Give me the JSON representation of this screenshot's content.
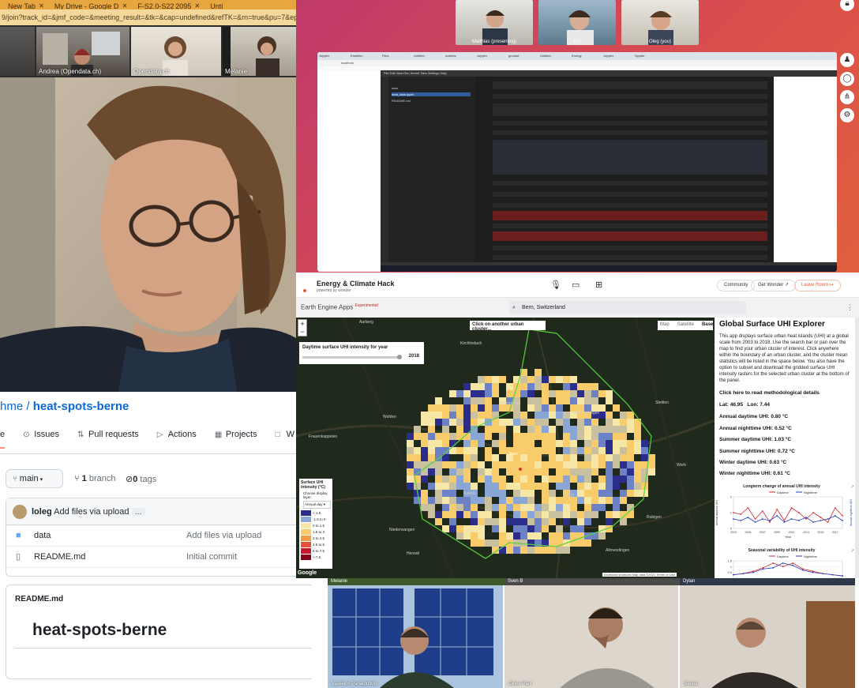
{
  "browser": {
    "tabs": [
      "New Tab",
      "My Drive - Google D",
      "F-S2.0-S22 2095",
      "Unti"
    ],
    "url": "9/join?track_id=&jmf_code=&meeting_result=&tk=&cap=undefined&refTK=&rn=true&pu=7&epk=8dFpZdV74"
  },
  "participants_top": [
    "Andrea (Opendata.ch)",
    "Opendata.ch",
    "Melanie"
  ],
  "participants_right": [
    "Matthias (presenting)",
    "Izzi",
    "Oleg (you)"
  ],
  "github": {
    "owner": "hme",
    "separator": " / ",
    "repo": "heat-spots-berne",
    "tabs": [
      {
        "icon": "⊙",
        "label": "Issues"
      },
      {
        "icon": "⇅",
        "label": "Pull requests"
      },
      {
        "icon": "▷",
        "label": "Actions"
      },
      {
        "icon": "▦",
        "label": "Projects"
      },
      {
        "icon": "□",
        "label": "W"
      }
    ],
    "first_tab_fragment": "e",
    "branch": "main",
    "branch_count": "1",
    "branch_label": "branch",
    "tag_count": "0",
    "tag_label": "tags",
    "commit_author": "loleg",
    "commit_message": "Add files via upload",
    "files": [
      {
        "name": "data",
        "message": "Add files via upload",
        "type": "folder"
      },
      {
        "name": "README.md",
        "message": "Initial commit",
        "type": "file"
      }
    ],
    "readme_label": "README.md",
    "readme_title": "heat-spots-berne"
  },
  "jupyter": {
    "address": "localhost",
    "tab_labels": [
      "Jupyter",
      "Erstellen",
      "Files",
      "Untitled",
      "mathviz",
      "Jupyter",
      "grundst",
      "Untitled",
      "Energy",
      "Jupyter",
      "Spyder"
    ],
    "file_items": [
      "data",
      "heat_data.ipynb",
      "README.md"
    ],
    "menu": "File  Edit  View  Run  Kernel  Tabs  Settings  Help"
  },
  "wonder": {
    "title": "Energy & Climate Hack",
    "subtitle": "powered by wonder",
    "community": "Community",
    "get_wonder": "Get Wonder",
    "leave_room": "Leave Room"
  },
  "earth_engine": {
    "title": "Earth Engine Apps",
    "badge": "Experimental",
    "search_value": "Bern, Switzerland"
  },
  "map": {
    "instruction": "Click on another urban cluster...",
    "map_types": [
      "Map",
      "Satellite",
      "Base"
    ],
    "year_panel_title": "Daytime surface UHI intensity for year",
    "year": "2018",
    "zoom_in": "+",
    "zoom_out": "−",
    "legend_title": "Surface UHI intensity (°C)",
    "legend_choose": "Choose display layer:",
    "legend_layer": "Annual day",
    "legend": [
      {
        "label": "< 1.5",
        "color": "#2b2d8a"
      },
      {
        "label": "-1.5 to 0",
        "color": "#8aa6d6"
      },
      {
        "label": "0 to 1.5",
        "color": "#f7e7a6"
      },
      {
        "label": "1.5 to 3",
        "color": "#f8cc6a"
      },
      {
        "label": "3 to 4.5",
        "color": "#f29c46"
      },
      {
        "label": "4.5 to 6",
        "color": "#e2543a"
      },
      {
        "label": "6 to 7.5",
        "color": "#c41a2a"
      },
      {
        "label": "> 7.5",
        "color": "#8a0016"
      }
    ],
    "places": [
      "Aarberg",
      "Kirchlindach",
      "Bremgarten",
      "Wohlen",
      "Frauenkappelen",
      "Bern",
      "Ostermundigen",
      "Muri",
      "Niederwangen",
      "Koeniz",
      "Allmendingen",
      "Rubigen",
      "Worb",
      "Stettlen",
      "Herzwil"
    ],
    "attribution": "Google",
    "footer": "Keyboard shortcuts   Map data ©2021   Terms of Use"
  },
  "panel": {
    "title": "Global Surface UHI Explorer",
    "description": "This app displays surface urban heat islands (UHI) at a global scale from 2003 to 2018. Use the search bar or pan over the map to find your urban cluster of interest. Click anywhere within the boundary of an urban cluster, and the cluster mean statistics will be listed in the space below. You also have the option to subset and download the gridded surface UHI intensity rasters for the selected urban cluster at the bottom of the panel.",
    "methods_link": "Click here to read methodological details",
    "lat": "Lat: 46.95",
    "lon": "Lon: 7.44",
    "stats": [
      "Annual daytime UHI: 0.80 °C",
      "Annual nighttime UHI: 0.52 °C",
      "Summer daytime UHI: 1.03 °C",
      "Summer nighttime UHI: 0.72 °C",
      "Winter daytime UHI: 0.63 °C",
      "Winter nighttime UHI: 0.61 °C"
    ]
  },
  "chart_data": [
    {
      "type": "line",
      "title": "Longterm change of annual UHI intensity",
      "x": [
        2003,
        2004,
        2005,
        2006,
        2007,
        2008,
        2009,
        2010,
        2011,
        2012,
        2013,
        2014,
        2015,
        2016,
        2017,
        2018
      ],
      "series": [
        {
          "name": "Daytime",
          "color": "#d62728",
          "values": [
            1.0,
            0.9,
            1.3,
            0.6,
            1.1,
            0.4,
            1.2,
            0.5,
            1.3,
            1.0,
            0.6,
            1.0,
            0.7,
            0.4,
            1.3,
            0.8
          ]
        },
        {
          "name": "Nighttime",
          "color": "#1f3fbf",
          "values": [
            0.6,
            0.5,
            0.7,
            0.4,
            0.6,
            0.5,
            0.8,
            0.4,
            0.6,
            0.5,
            0.7,
            0.4,
            0.5,
            0.6,
            0.8,
            0.5
          ]
        }
      ],
      "xlabel": "Year",
      "ylabel": "Annual daytime UHI",
      "y2label": "Annual nighttime UHI",
      "ylim": [
        0,
        2
      ],
      "yticks": [
        0,
        1,
        2
      ],
      "xticks": [
        2003,
        2005,
        2007,
        2009,
        2011,
        2013,
        2015,
        2017
      ]
    },
    {
      "type": "line",
      "title": "Seasonal variability of UHI intensity",
      "x": [
        1,
        2,
        3,
        4,
        5,
        6,
        7,
        8,
        9,
        10,
        11,
        12
      ],
      "series": [
        {
          "name": "Daytime",
          "color": "#d62728",
          "values": [
            0.3,
            0.4,
            0.6,
            0.9,
            1.3,
            1.0,
            1.3,
            0.8,
            0.6,
            0.4,
            0.3,
            0.2
          ]
        },
        {
          "name": "Nighttime",
          "color": "#1f3fbf",
          "values": [
            0.3,
            0.4,
            0.5,
            0.8,
            0.9,
            1.3,
            1.1,
            0.7,
            0.5,
            0.4,
            0.3,
            0.2
          ]
        }
      ],
      "ylim": [
        0,
        1.5
      ],
      "yticks": [
        0.5,
        1.0,
        1.5
      ]
    }
  ],
  "participants_bottom": [
    "Melanie",
    "Sven B",
    "Dylan",
    "Vasileios Panagiotidis",
    "Oliver Paul",
    "Saeed"
  ]
}
